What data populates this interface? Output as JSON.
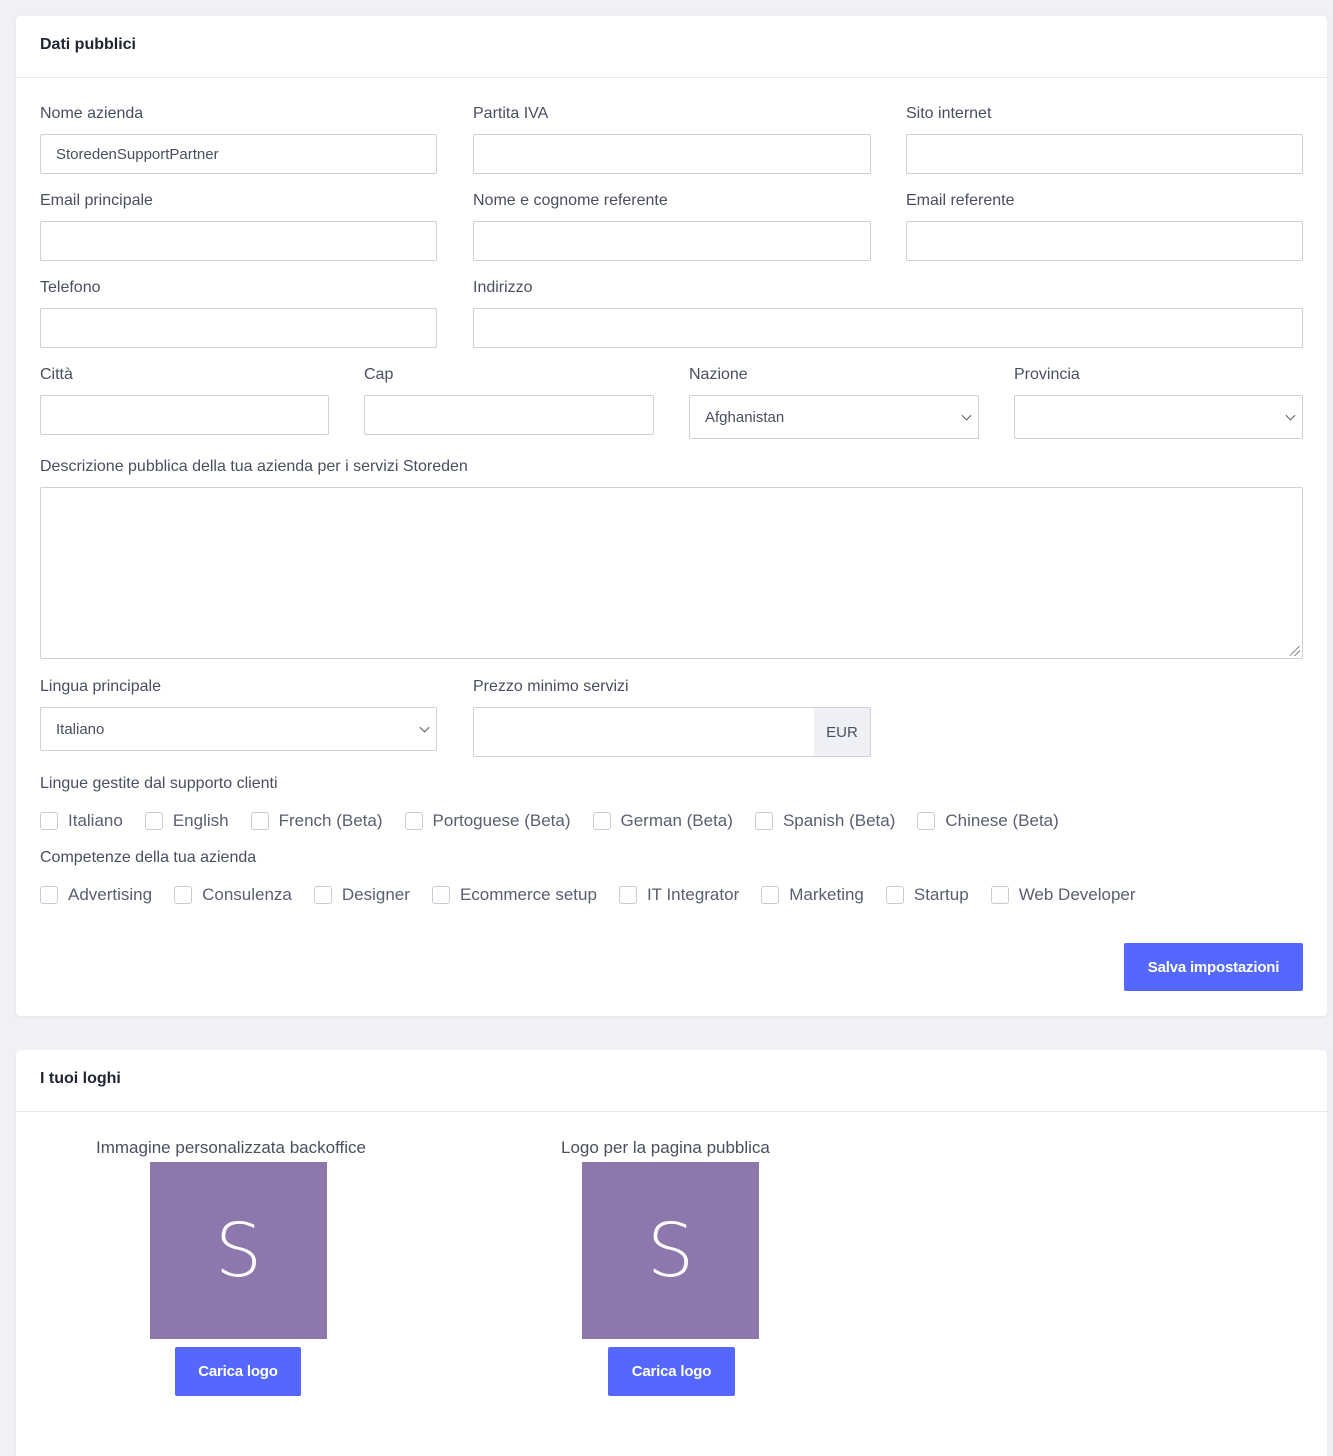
{
  "public_data": {
    "title": "Dati pubblici",
    "company_name": {
      "label": "Nome azienda",
      "value": "StoredenSupportPartner"
    },
    "vat": {
      "label": "Partita IVA",
      "value": ""
    },
    "website": {
      "label": "Sito internet",
      "value": ""
    },
    "main_email": {
      "label": "Email principale",
      "value": ""
    },
    "contact_name": {
      "label": "Nome e cognome referente",
      "value": ""
    },
    "contact_email": {
      "label": "Email referente",
      "value": ""
    },
    "phone": {
      "label": "Telefono",
      "value": ""
    },
    "address": {
      "label": "Indirizzo",
      "value": ""
    },
    "city": {
      "label": "Città",
      "value": ""
    },
    "zip": {
      "label": "Cap",
      "value": ""
    },
    "country": {
      "label": "Nazione",
      "value": "Afghanistan"
    },
    "province": {
      "label": "Provincia",
      "value": ""
    },
    "description": {
      "label": "Descrizione pubblica della tua azienda per i servizi Storeden",
      "value": ""
    },
    "main_language": {
      "label": "Lingua principale",
      "value": "Italiano"
    },
    "min_price": {
      "label": "Prezzo minimo servizi",
      "value": "",
      "currency": "EUR"
    },
    "support_languages": {
      "label": "Lingue gestite dal supporto clienti",
      "options": [
        "Italiano",
        "English",
        "French (Beta)",
        "Portoguese (Beta)",
        "German (Beta)",
        "Spanish (Beta)",
        "Chinese (Beta)"
      ]
    },
    "skills": {
      "label": "Competenze della tua azienda",
      "options": [
        "Advertising",
        "Consulenza",
        "Designer",
        "Ecommerce setup",
        "IT Integrator",
        "Marketing",
        "Startup",
        "Web Developer"
      ]
    },
    "save_label": "Salva impostazioni"
  },
  "logos": {
    "title": "I tuoi loghi",
    "backoffice": {
      "label": "Immagine personalizzata backoffice",
      "initial": "S",
      "button": "Carica logo"
    },
    "public": {
      "label": "Logo per la pagina pubblica",
      "initial": "S",
      "button": "Carica logo"
    }
  },
  "colors": {
    "accent": "#5468ff",
    "logo_bg": "#8e77ad",
    "page_bg": "#f0f0f6"
  }
}
